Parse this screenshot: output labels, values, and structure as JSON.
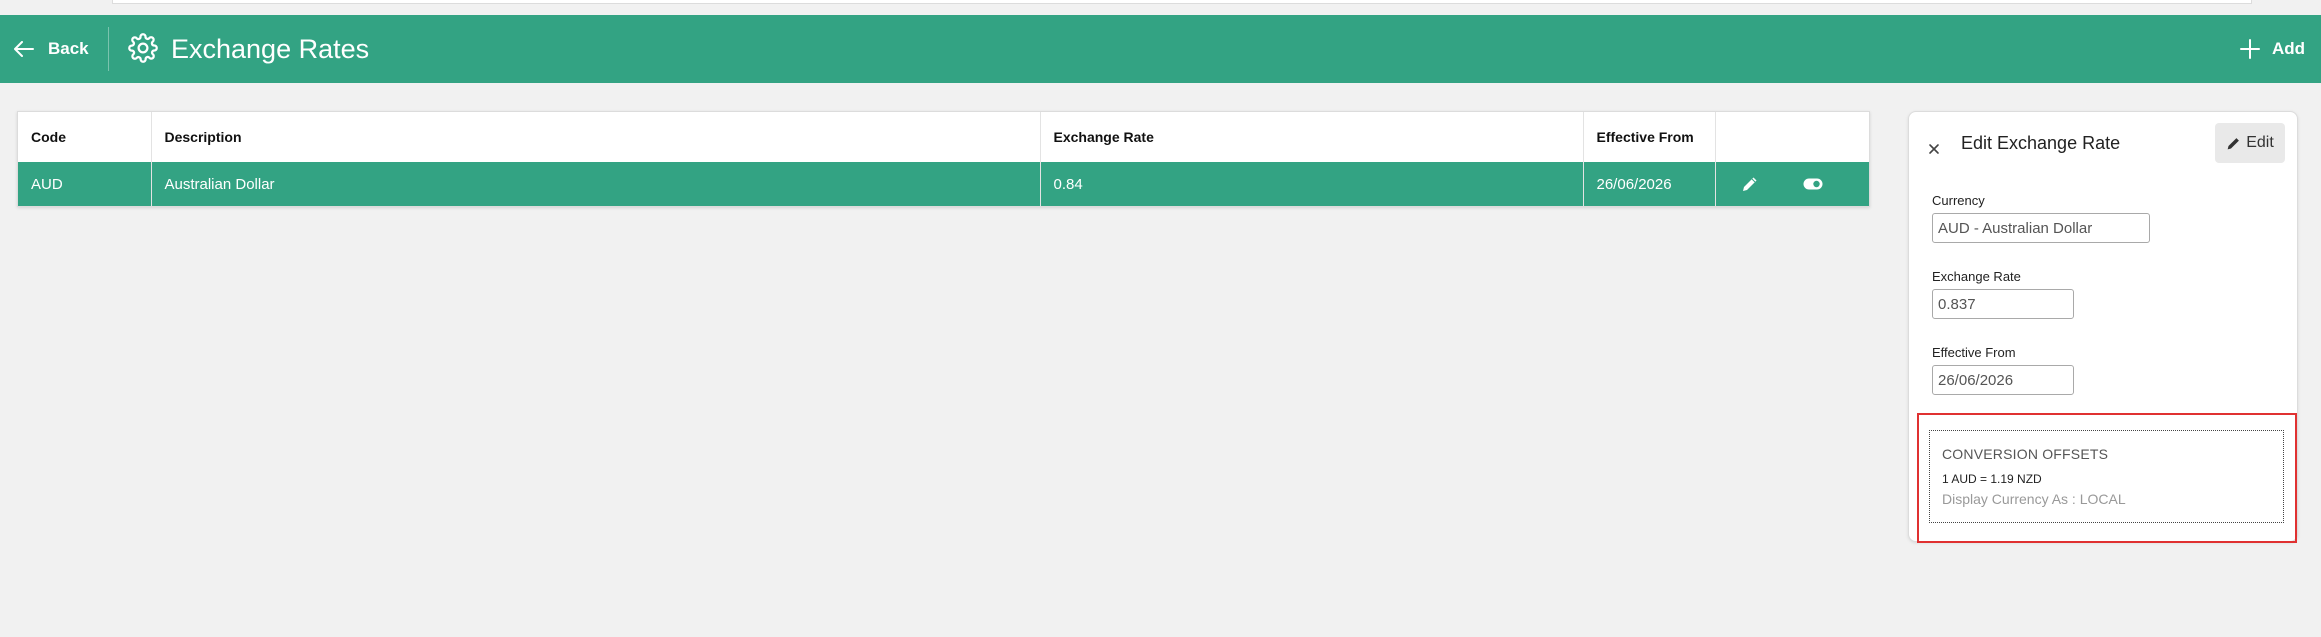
{
  "header": {
    "back_label": "Back",
    "title": "Exchange Rates",
    "add_label": "Add",
    "bg_color": "#33a383"
  },
  "table": {
    "columns": [
      "Code",
      "Description",
      "Exchange Rate",
      "Effective From",
      ""
    ],
    "rows": [
      {
        "code": "AUD",
        "description": "Australian Dollar",
        "rate": "0.84",
        "effective_from": "26/06/2026",
        "selected": true
      }
    ]
  },
  "panel": {
    "title": "Edit Exchange Rate",
    "edit_label": "Edit",
    "currency_label": "Currency",
    "currency_value": "AUD - Australian Dollar",
    "rate_label": "Exchange Rate",
    "rate_value": "0.837",
    "effective_label": "Effective From",
    "effective_value": "26/06/2026",
    "conversion": {
      "title": "CONVERSION OFFSETS",
      "line": "1 AUD = 1.19 NZD",
      "display": "Display Currency As : LOCAL"
    }
  },
  "highlight_color": "#e03131"
}
